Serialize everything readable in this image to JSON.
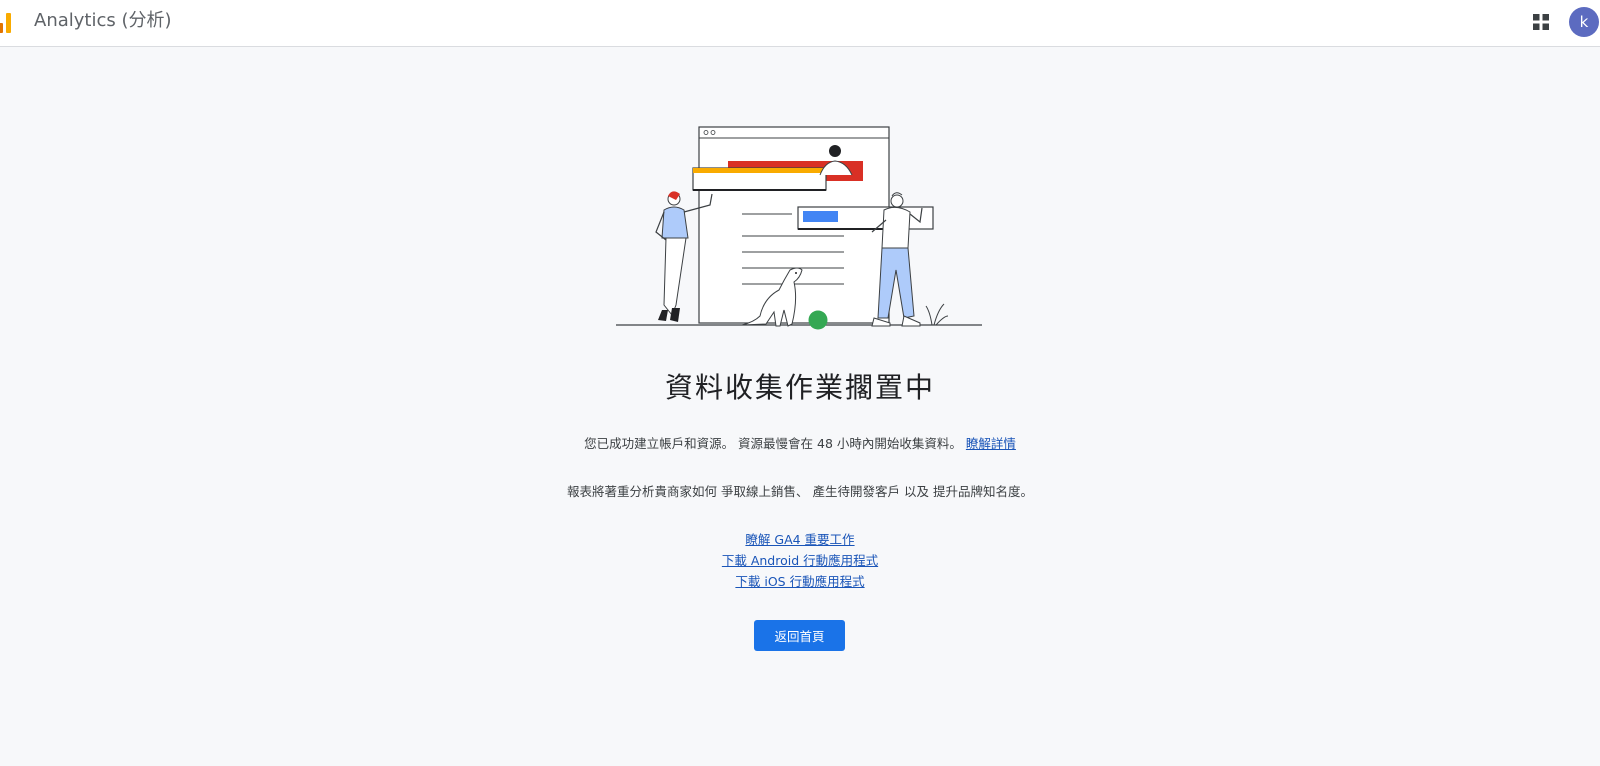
{
  "header": {
    "title": "Analytics (分析)",
    "avatar_letter": "k"
  },
  "main": {
    "heading": "資料收集作業擱置中",
    "message_text": "您已成功建立帳戶和資源。 資源最慢會在 48 小時內開始收集資料。",
    "learn_more_link": "瞭解詳情",
    "report_text": "報表將著重分析貴商家如何 爭取線上銷售、 產生待開發客戶 以及 提升品牌知名度。",
    "links": [
      "瞭解 GA4 重要工作",
      "下載 Android 行動應用程式",
      "下載 iOS 行動應用程式"
    ],
    "home_button": "返回首頁"
  },
  "colors": {
    "accent": "#1a73e8",
    "link": "#1a55b8",
    "avatar": "#5c6bc0",
    "logo_orange": "#f9ab00",
    "logo_dark_orange": "#e37400",
    "illustration_red": "#d93025",
    "illustration_yellow": "#f9ab00",
    "illustration_blue": "#4285f4",
    "illustration_green": "#34a853"
  }
}
